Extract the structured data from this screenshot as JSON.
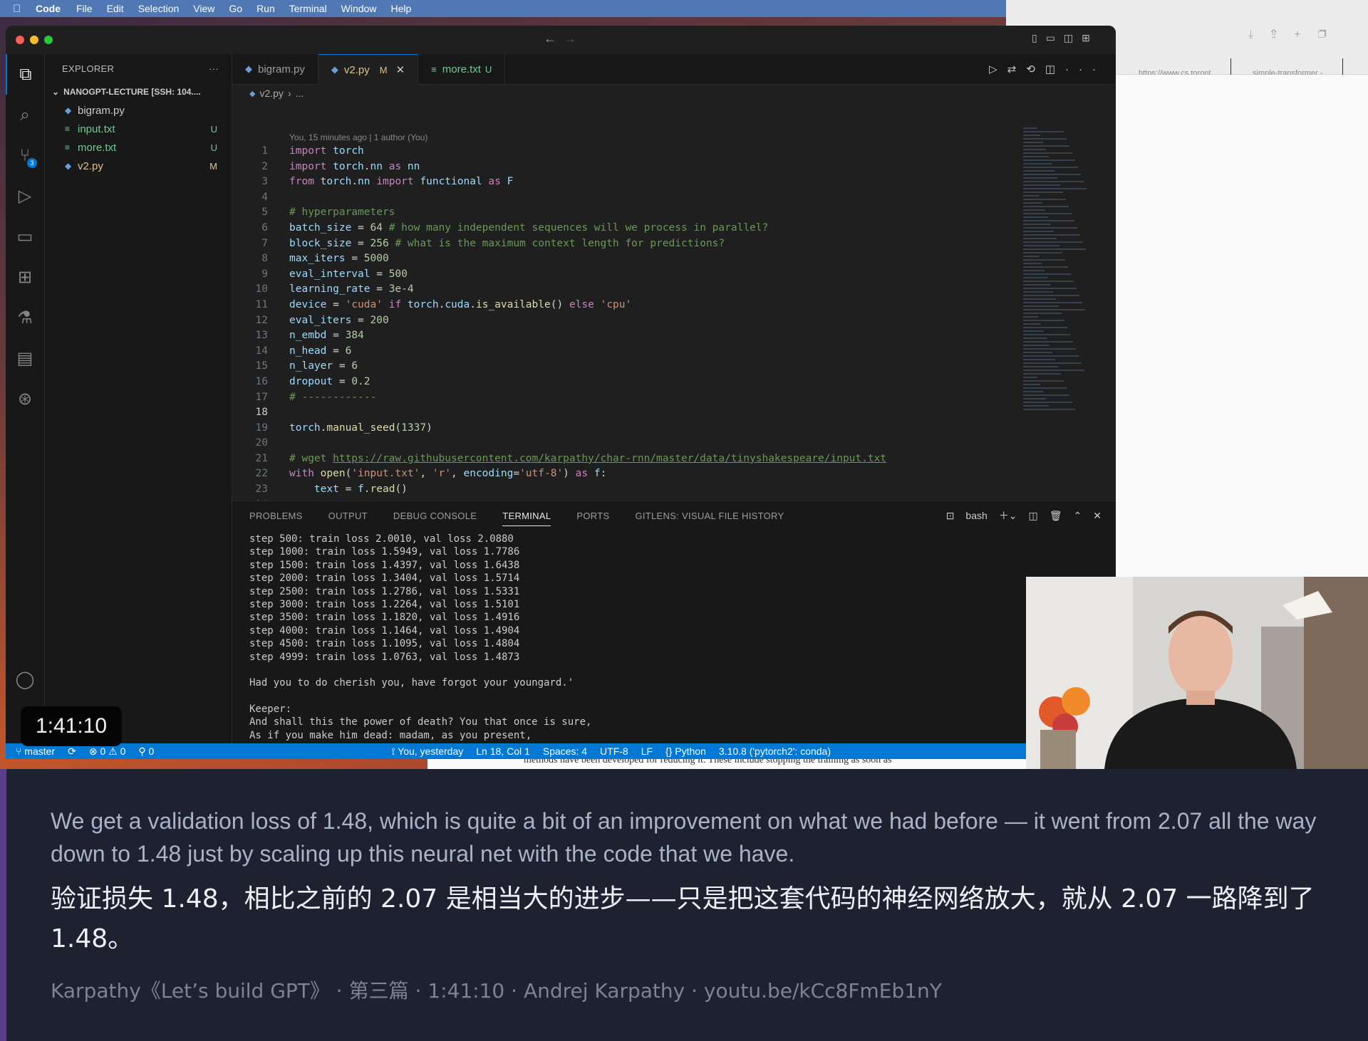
{
  "menubar": {
    "app": "Code",
    "items": [
      "File",
      "Edit",
      "Selection",
      "View",
      "Go",
      "Run",
      "Terminal",
      "Window",
      "Help"
    ]
  },
  "browser": {
    "tab1": "https://www.cs.toront...",
    "tab2": "simple-transformer -..."
  },
  "paper_strip": "methods have been developed for reducing it.  These include stopping the training as soon as",
  "sidebar": {
    "title": "EXPLORER",
    "folder": "NANOGPT-LECTURE [SSH: 104....",
    "files": [
      {
        "name": "bigram.py",
        "status": ""
      },
      {
        "name": "input.txt",
        "status": "U"
      },
      {
        "name": "more.txt",
        "status": "U"
      },
      {
        "name": "v2.py",
        "status": "M"
      }
    ]
  },
  "tabs": [
    {
      "label": "bigram.py",
      "mod": ""
    },
    {
      "label": "v2.py",
      "mod": "M"
    },
    {
      "label": "more.txt",
      "mod": "U"
    }
  ],
  "breadcrumb": {
    "file": "v2.py",
    "rest": "..."
  },
  "blame": "You, 15 minutes ago | 1 author (You)",
  "code_lines": [
    "import torch",
    "import torch.nn as nn",
    "from torch.nn import functional as F",
    "",
    "# hyperparameters",
    "batch_size = 64 # how many independent sequences will we process in parallel?",
    "block_size = 256 # what is the maximum context length for predictions?",
    "max_iters = 5000",
    "eval_interval = 500",
    "learning_rate = 3e-4",
    "device = 'cuda' if torch.cuda.is_available() else 'cpu'",
    "eval_iters = 200",
    "n_embd = 384",
    "n_head = 6",
    "n_layer = 6",
    "dropout = 0.2",
    "# ------------",
    "",
    "torch.manual_seed(1337)",
    "",
    "# wget https://raw.githubusercontent.com/karpathy/char-rnn/master/data/tinyshakespeare/input.txt",
    "with open('input.txt', 'r', encoding='utf-8') as f:",
    "    text = f.read()",
    ""
  ],
  "panel": {
    "tabs": [
      "PROBLEMS",
      "OUTPUT",
      "DEBUG CONSOLE",
      "TERMINAL",
      "PORTS",
      "GITLENS: VISUAL FILE HISTORY"
    ],
    "active_tab": "TERMINAL",
    "shell": "bash"
  },
  "terminal_lines": [
    "step 500: train loss 2.0010, val loss 2.0880",
    "step 1000: train loss 1.5949, val loss 1.7786",
    "step 1500: train loss 1.4397, val loss 1.6438",
    "step 2000: train loss 1.3404, val loss 1.5714",
    "step 2500: train loss 1.2786, val loss 1.5331",
    "step 3000: train loss 1.2264, val loss 1.5101",
    "step 3500: train loss 1.1820, val loss 1.4916",
    "step 4000: train loss 1.1464, val loss 1.4904",
    "step 4500: train loss 1.1095, val loss 1.4804",
    "step 4999: train loss 1.0763, val loss 1.4873",
    "",
    "Had you to do cherish you, have forgot your youngard.'",
    "",
    "Keeper:",
    "And shall this the power of death? You that once is sure,",
    "As if you make him dead: madam, as you present,"
  ],
  "statusbar": {
    "branch": "master",
    "errors": "0",
    "warnings": "0",
    "ports": "0",
    "blame": "You, yesterday",
    "position": "Ln 18, Col 1",
    "spaces": "Spaces: 4",
    "encoding": "UTF-8",
    "eol": "LF",
    "language": "Python",
    "interpreter": "3.10.8 ('pytorch2': conda)"
  },
  "timestamp": "1:41:10",
  "caption": {
    "en": "We get a validation loss of 1.48, which is quite a bit of an improvement on what we had before — it went from 2.07 all the way down to 1.48 just by scaling up this neural net with the code that we have.",
    "zh": "验证损失 1.48，相比之前的 2.07 是相当大的进步——只是把这套代码的神经网络放大，就从 2.07 一路降到了 1.48。",
    "source": "Karpathy《Let’s build GPT》 · 第三篇 · 1:41:10 · Andrej Karpathy · youtu.be/kCc8FmEb1nY"
  },
  "colors": {
    "accent": "#0078d4",
    "modified": "#e2c08d",
    "untracked": "#73c991",
    "caption_bg": "#1e2130"
  }
}
